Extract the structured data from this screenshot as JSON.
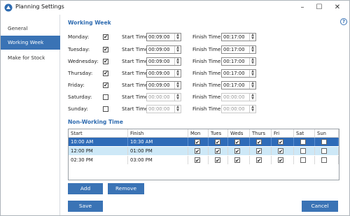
{
  "window": {
    "title": "Planning Settings"
  },
  "sidebar": {
    "items": [
      {
        "label": "General",
        "active": false
      },
      {
        "label": "Working Week",
        "active": true
      },
      {
        "label": "Make for Stock",
        "active": false
      }
    ]
  },
  "working_week": {
    "title": "Working Week",
    "start_label": "Start Time:",
    "finish_label": "Finish Time:",
    "days": [
      {
        "day": "Monday:",
        "checked": true,
        "start": "00:09:00",
        "finish": "00:17:00"
      },
      {
        "day": "Tuesday:",
        "checked": true,
        "start": "00:09:00",
        "finish": "00:17:00"
      },
      {
        "day": "Wednesday:",
        "checked": true,
        "start": "00:09:00",
        "finish": "00:17:00"
      },
      {
        "day": "Thursday:",
        "checked": true,
        "start": "00:09:00",
        "finish": "00:17:00"
      },
      {
        "day": "Friday:",
        "checked": true,
        "start": "00:09:00",
        "finish": "00:17:00"
      },
      {
        "day": "Saturday:",
        "checked": false,
        "start": "00:00:00",
        "finish": "00:00:00"
      },
      {
        "day": "Sunday:",
        "checked": false,
        "start": "00:00:00",
        "finish": "00:00:00"
      }
    ]
  },
  "non_working": {
    "title": "Non-Working Time",
    "columns": [
      "Start",
      "Finish",
      "Mon",
      "Tues",
      "Weds",
      "Thurs",
      "Fri",
      "Sat",
      "Sun"
    ],
    "rows": [
      {
        "start": "10:00 AM",
        "finish": "10:30 AM",
        "days": [
          true,
          true,
          true,
          true,
          true,
          false,
          false
        ]
      },
      {
        "start": "12:00 PM",
        "finish": "01:00 PM",
        "days": [
          true,
          true,
          true,
          true,
          true,
          false,
          false
        ]
      },
      {
        "start": "02:30 PM",
        "finish": "03:00 PM",
        "days": [
          true,
          true,
          true,
          true,
          true,
          false,
          false
        ]
      }
    ]
  },
  "buttons": {
    "add": "Add",
    "remove": "Remove",
    "save": "Save",
    "cancel": "Cancel"
  },
  "icons": {
    "app": "planning-settings-icon",
    "help": "help-icon"
  },
  "colors": {
    "accent": "#3a73b5",
    "header": "#2e6bb0",
    "selected_row": "#2e6bb8",
    "hover_row": "#cde8f7"
  }
}
